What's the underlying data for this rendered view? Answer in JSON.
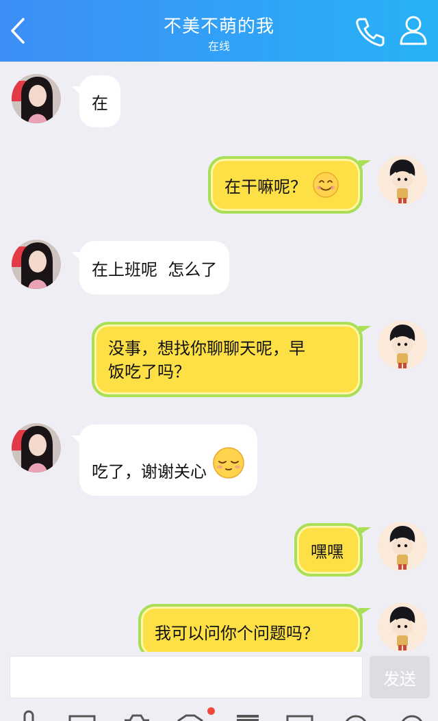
{
  "header": {
    "title": "不美不萌的我",
    "status": "在线"
  },
  "messages": [
    {
      "side": "in",
      "text": "在"
    },
    {
      "side": "out",
      "text": "在干嘛呢？",
      "emoji": "smile-emoji"
    },
    {
      "side": "in",
      "text": "在上班呢  怎么了"
    },
    {
      "side": "out",
      "line1": "没事，想找你聊聊天呢，早",
      "line2": "饭吃了吗？"
    },
    {
      "side": "in",
      "text": "吃了，谢谢关心",
      "emoji": "shy-emoji"
    },
    {
      "side": "out",
      "text": "嘿嘿"
    },
    {
      "side": "out",
      "text": "我可以问你个问题吗？"
    }
  ],
  "composer": {
    "input_value": "",
    "send_label": "发送"
  },
  "colors": {
    "header_start": "#3d8ef5",
    "header_end": "#27b2f6",
    "out_bubble": "#fde046",
    "out_border": "#a9de57",
    "badge": "#f0493e"
  }
}
